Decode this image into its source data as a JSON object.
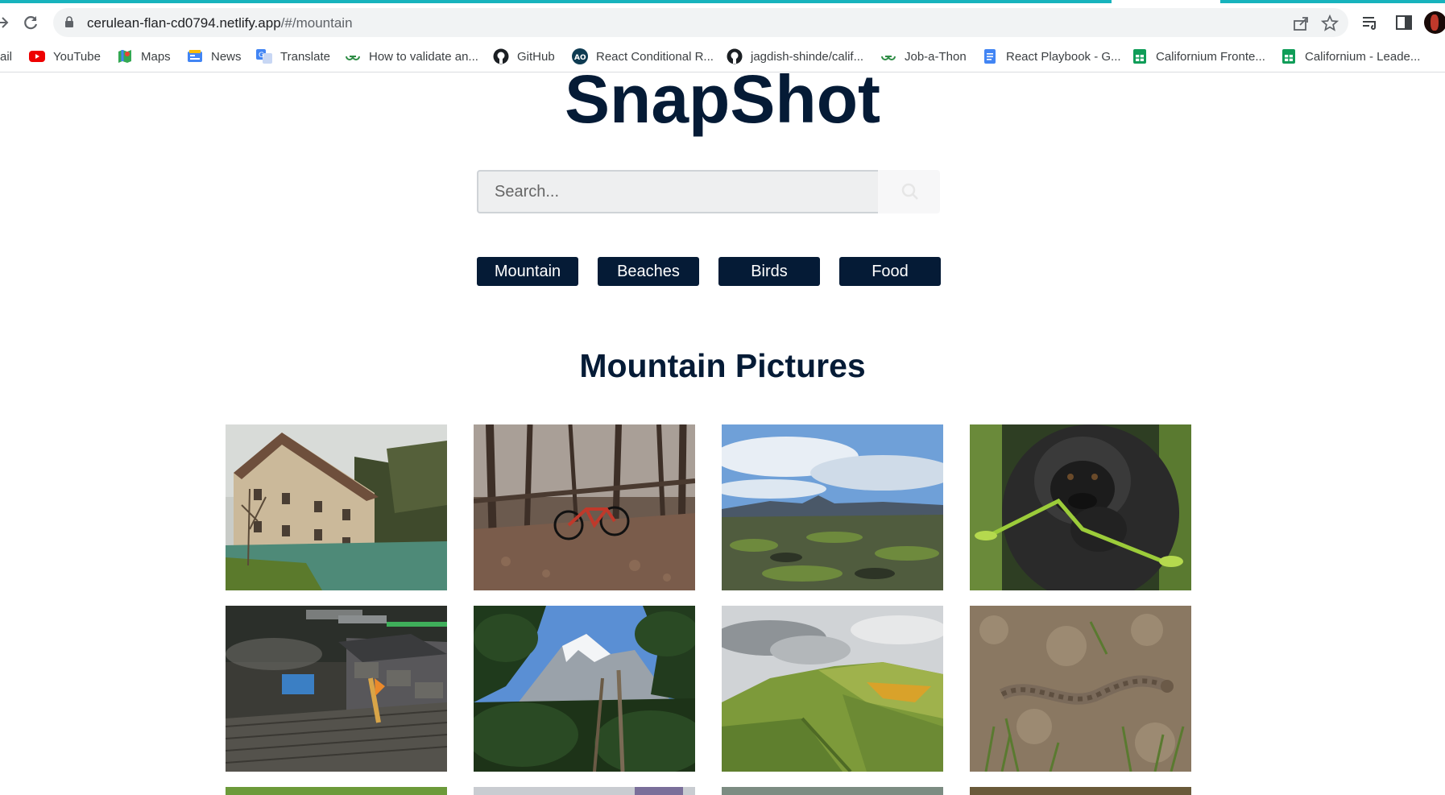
{
  "browser": {
    "url_host": "cerulean-flan-cd0794.netlify.app",
    "url_path": "/#/mountain",
    "bookmarks": [
      {
        "label": "ail",
        "icon": "gmail-icon"
      },
      {
        "label": "YouTube",
        "icon": "youtube-icon"
      },
      {
        "label": "Maps",
        "icon": "maps-icon"
      },
      {
        "label": "News",
        "icon": "news-icon"
      },
      {
        "label": "Translate",
        "icon": "translate-icon"
      },
      {
        "label": "How to validate an...",
        "icon": "gfg-icon"
      },
      {
        "label": "GitHub",
        "icon": "github-icon"
      },
      {
        "label": "React Conditional R...",
        "icon": "ao-icon"
      },
      {
        "label": "jagdish-shinde/calif...",
        "icon": "github-icon"
      },
      {
        "label": "Job-a-Thon",
        "icon": "gfg-icon"
      },
      {
        "label": "React Playbook - G...",
        "icon": "docs-icon"
      },
      {
        "label": "Californium Fronte...",
        "icon": "sheets-icon"
      },
      {
        "label": "Californium - Leade...",
        "icon": "sheets-icon"
      }
    ]
  },
  "app": {
    "title": "SnapShot",
    "search_placeholder": "Search...",
    "categories": [
      "Mountain",
      "Beaches",
      "Birds",
      "Food"
    ],
    "section_title": "Mountain Pictures"
  },
  "colors": {
    "brand": "#051b36",
    "loading": "#17b3bd"
  },
  "photos": [
    {
      "subject": "stone house by river"
    },
    {
      "subject": "bicycle in forest"
    },
    {
      "subject": "lava field landscape"
    },
    {
      "subject": "gorilla"
    },
    {
      "subject": "mountain village rooftops"
    },
    {
      "subject": "snowy peak through trees"
    },
    {
      "subject": "green hills"
    },
    {
      "subject": "snake on ground"
    }
  ]
}
